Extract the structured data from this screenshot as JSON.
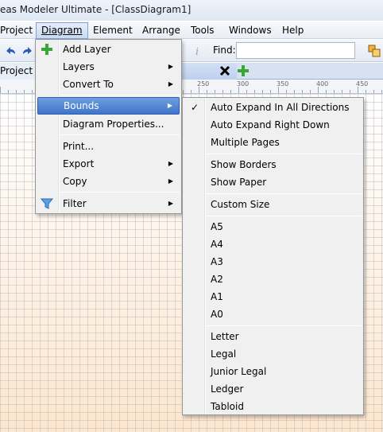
{
  "window": {
    "title": "eas Modeler Ultimate - [ClassDiagram1]"
  },
  "menubar": {
    "items": [
      "Project",
      "Diagram",
      "Element",
      "Arrange",
      "Tools",
      "Windows",
      "Help"
    ]
  },
  "toolbar": {
    "find_label": "Find:",
    "find_value": ""
  },
  "tabs": {
    "left": "Project Pr",
    "diagram": ""
  },
  "ruler": {
    "labels": [
      "250",
      "300",
      "350",
      "400",
      "450"
    ]
  },
  "diagram_menu": {
    "items": [
      {
        "label": "Add Layer",
        "icon": "plus-icon",
        "submenu": false
      },
      {
        "label": "Layers",
        "submenu": true
      },
      {
        "label": "Convert To",
        "submenu": true
      },
      {
        "label": "Bounds",
        "submenu": true,
        "highlighted": true
      },
      {
        "label": "Diagram Properties...",
        "submenu": false
      },
      {
        "label": "Print...",
        "submenu": false
      },
      {
        "label": "Export",
        "submenu": true
      },
      {
        "label": "Copy",
        "submenu": true
      },
      {
        "label": "Filter",
        "icon": "funnel-icon",
        "submenu": true
      }
    ]
  },
  "bounds_menu": {
    "items": [
      {
        "label": "Auto Expand In All Directions",
        "checked": true
      },
      {
        "label": "Auto Expand Right Down"
      },
      {
        "label": "Multiple Pages"
      },
      {
        "label": "Show Borders"
      },
      {
        "label": "Show Paper"
      },
      {
        "label": "Custom Size"
      },
      {
        "label": "A5"
      },
      {
        "label": "A4"
      },
      {
        "label": "A3"
      },
      {
        "label": "A2"
      },
      {
        "label": "A1"
      },
      {
        "label": "A0"
      },
      {
        "label": "Letter"
      },
      {
        "label": "Legal"
      },
      {
        "label": "Junior Legal"
      },
      {
        "label": "Ledger"
      },
      {
        "label": "Tabloid"
      }
    ]
  },
  "glyphs": {
    "arrow": "▶",
    "check": "✓"
  },
  "colors": {
    "highlight": "#3f74c9",
    "canvas": "#fdf0e2"
  }
}
